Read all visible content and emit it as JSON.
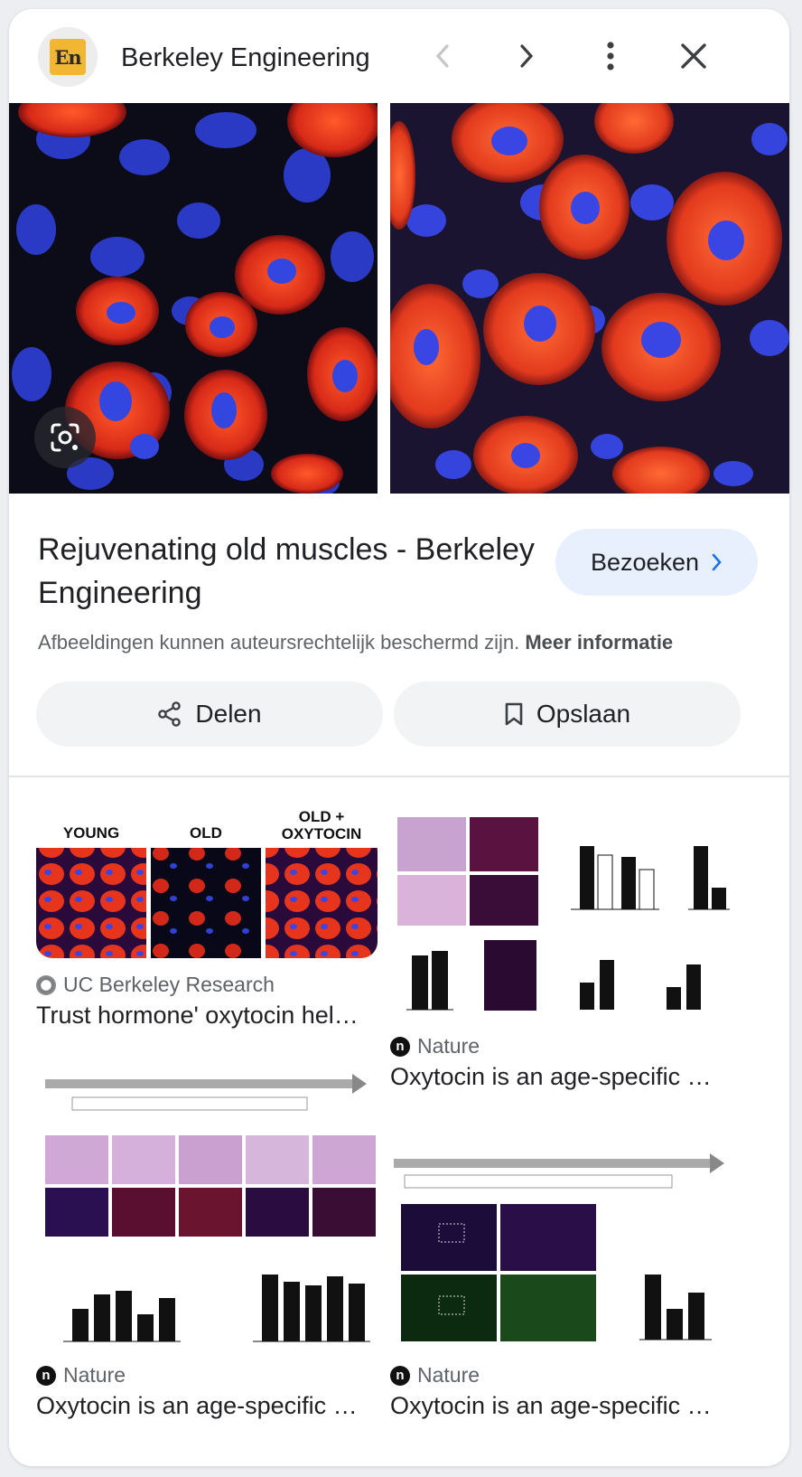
{
  "header": {
    "logo_text": "En",
    "site_name": "Berkeley Engineering",
    "prev_icon": "chevron-left-icon",
    "next_icon": "chevron-right-icon",
    "more_icon": "more-vert-icon",
    "close_icon": "close-icon"
  },
  "main": {
    "title": "Rejuvenating old muscles - Berkeley Engineering",
    "visit_label": "Bezoeken",
    "copyright_text": "Afbeeldingen kunnen auteursrechtelijk beschermd zijn.",
    "more_info_label": "Meer informatie",
    "share_label": "Delen",
    "save_label": "Opslaan"
  },
  "related": [
    {
      "source": "UC Berkeley Research",
      "title": "Trust hormone' oxytocin hel…",
      "panel_labels": [
        "YOUNG",
        "OLD",
        "OLD +\nOXYTOCIN"
      ]
    },
    {
      "source": "Nature",
      "title": "Oxytocin is an age-specific …"
    },
    {
      "source": "Nature",
      "title": "Oxytocin is an age-specific …"
    },
    {
      "source": "Nature",
      "title": "Oxytocin is an age-specific …"
    }
  ],
  "colors": {
    "accent_chip": "#e8f0fe",
    "muscle_red": "#e8331c",
    "nucleus_blue": "#3a4de8"
  }
}
